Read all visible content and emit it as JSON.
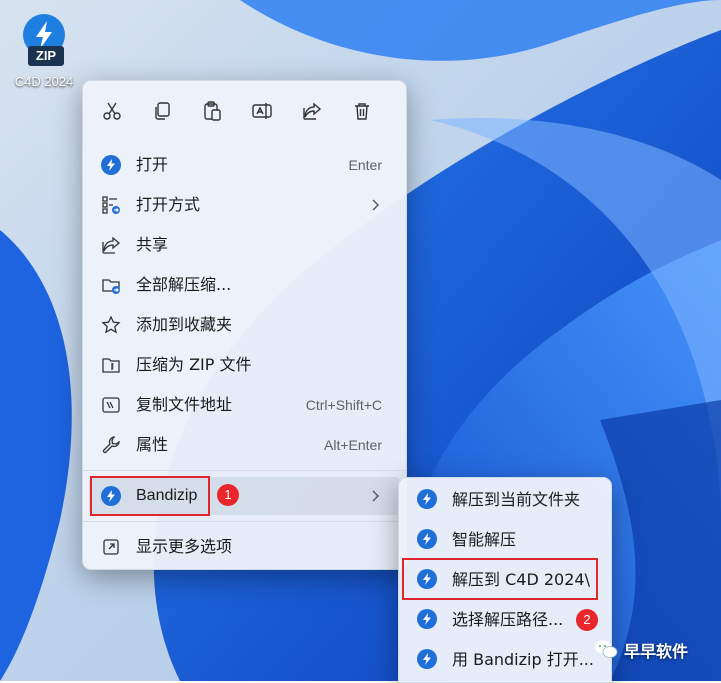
{
  "desktop": {
    "icon": {
      "tag": "ZIP",
      "label": "C4D 2024"
    }
  },
  "context_menu": {
    "toolbar": [
      "cut-icon",
      "copy-icon",
      "paste-icon",
      "rename-icon",
      "share-icon",
      "delete-icon"
    ],
    "items": [
      {
        "label": "打开",
        "shortcut": "Enter"
      },
      {
        "label": "打开方式",
        "has_submenu": true
      },
      {
        "label": "共享"
      },
      {
        "label": "全部解压缩..."
      },
      {
        "label": "添加到收藏夹"
      },
      {
        "label": "压缩为 ZIP 文件"
      },
      {
        "label": "复制文件地址",
        "shortcut": "Ctrl+Shift+C"
      },
      {
        "label": "属性",
        "shortcut": "Alt+Enter"
      },
      {
        "label": "Bandizip",
        "has_submenu": true,
        "highlighted": true
      },
      {
        "label": "显示更多选项"
      }
    ]
  },
  "bandizip_submenu": {
    "items": [
      {
        "label": "解压到当前文件夹"
      },
      {
        "label": "智能解压"
      },
      {
        "label": "解压到 C4D 2024\\"
      },
      {
        "label": "选择解压路径..."
      },
      {
        "label": "用 Bandizip 打开..."
      }
    ]
  },
  "annotations": {
    "badge1": "1",
    "badge2": "2",
    "highlight_color": "#e0252c"
  },
  "watermark": {
    "text": "早早软件"
  },
  "colors": {
    "accent": "#1f6fd6",
    "menu_bg": "#eef2fa",
    "wallpaper": "#1a5fd8"
  }
}
